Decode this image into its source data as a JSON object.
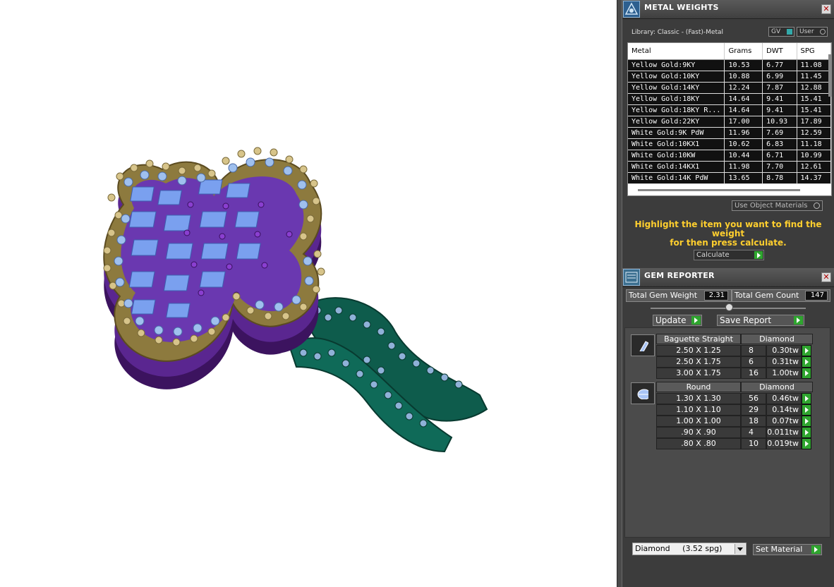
{
  "metal_weights": {
    "title": "METAL WEIGHTS",
    "library": "Library: Classic - (Fast)-Metal",
    "toggle_gv": "GV",
    "toggle_user": "User",
    "columns": [
      "Metal",
      "Grams",
      "DWT",
      "SPG"
    ],
    "rows": [
      [
        "Yellow Gold:9KY",
        "10.53",
        "6.77",
        "11.08"
      ],
      [
        "Yellow Gold:10KY",
        "10.88",
        "6.99",
        "11.45"
      ],
      [
        "Yellow Gold:14KY",
        "12.24",
        "7.87",
        "12.88"
      ],
      [
        "Yellow Gold:18KY",
        "14.64",
        "9.41",
        "15.41"
      ],
      [
        "Yellow Gold:18KY R...",
        "14.64",
        "9.41",
        "15.41"
      ],
      [
        "Yellow Gold:22KY",
        "17.00",
        "10.93",
        "17.89"
      ],
      [
        "White Gold:9K PdW",
        "11.96",
        "7.69",
        "12.59"
      ],
      [
        "White Gold:10KX1",
        "10.62",
        "6.83",
        "11.18"
      ],
      [
        "White Gold:10KW",
        "10.44",
        "6.71",
        "10.99"
      ],
      [
        "White Gold:14KX1",
        "11.98",
        "7.70",
        "12.61"
      ],
      [
        "White Gold:14K PdW",
        "13.65",
        "8.78",
        "14.37"
      ]
    ],
    "use_object_materials": "Use Object Materials",
    "hint_line1": "Highlight the item you want to find the weight",
    "hint_line2": "for then press calculate.",
    "calculate": "Calculate"
  },
  "gem_reporter": {
    "title": "GEM REPORTER",
    "total_weight_label": "Total Gem Weight",
    "total_weight_value": "2.31",
    "total_count_label": "Total Gem Count",
    "total_count_value": "147",
    "update": "Update",
    "save_report": "Save Report",
    "groups": [
      {
        "icon": "baguette-gem-icon",
        "shape": "Baguette Straight",
        "material": "Diamond",
        "rows": [
          {
            "size": "2.50 X 1.25",
            "count": "8",
            "tw": "0.30tw"
          },
          {
            "size": "2.50 X 1.75",
            "count": "6",
            "tw": "0.31tw"
          },
          {
            "size": "3.00 X 1.75",
            "count": "16",
            "tw": "1.00tw"
          }
        ]
      },
      {
        "icon": "round-gem-icon",
        "shape": "Round",
        "material": "Diamond",
        "rows": [
          {
            "size": "1.30 X 1.30",
            "count": "56",
            "tw": "0.46tw"
          },
          {
            "size": "1.10 X 1.10",
            "count": "29",
            "tw": "0.14tw"
          },
          {
            "size": "1.00 X 1.00",
            "count": "18",
            "tw": "0.07tw"
          },
          {
            "size": ".90 X .90",
            "count": "4",
            "tw": "0.011tw"
          },
          {
            "size": ".80 X .80",
            "count": "10",
            "tw": "0.019tw"
          }
        ]
      }
    ],
    "material_select": "Diamond     (3.52 spg)",
    "set_material": "Set Material"
  },
  "colors": {
    "panel_bg": "#3c3c3c",
    "hint": "#ffcf2e",
    "go_green": "#2fa52f",
    "gold": "#c8b37a",
    "purple": "#4a1a74",
    "blue_stone": "#6f93e6",
    "green_metal": "#0f5a4a"
  }
}
